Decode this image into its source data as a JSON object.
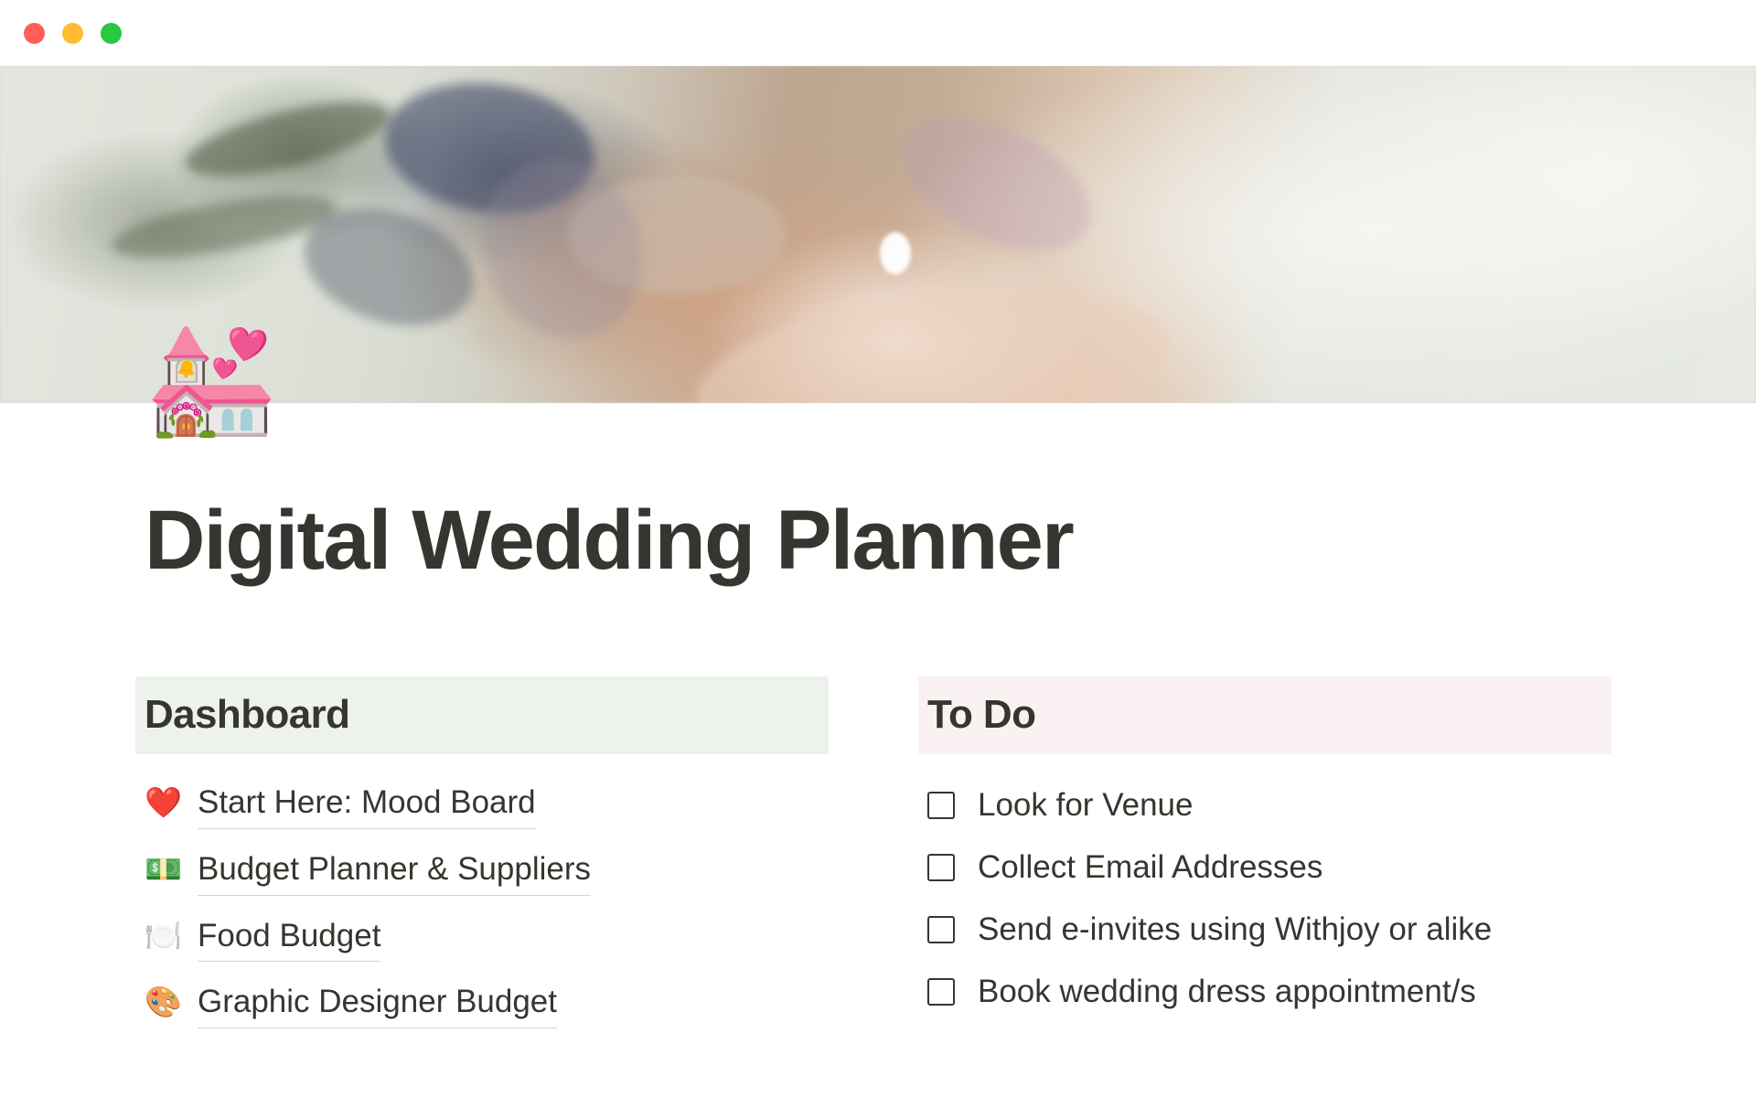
{
  "window": {
    "traffic_lights": [
      {
        "name": "close",
        "color": "#ff5f57"
      },
      {
        "name": "minimize",
        "color": "#febc2e"
      },
      {
        "name": "zoom",
        "color": "#28c840"
      }
    ]
  },
  "cover": {
    "alt": "blurred photo of hands holding dried floral bouquet with engagement ring"
  },
  "page": {
    "icon": "💒",
    "title": "Digital Wedding Planner"
  },
  "dashboard": {
    "heading": "Dashboard",
    "highlight_color": "#edf3ec",
    "links": [
      {
        "emoji": "❤️",
        "label": "Start Here: Mood Board"
      },
      {
        "emoji": "💵",
        "label": "Budget Planner & Suppliers"
      },
      {
        "emoji": "🍽️",
        "label": "Food Budget"
      },
      {
        "emoji": "🎨",
        "label": "Graphic Designer Budget"
      }
    ]
  },
  "todo": {
    "heading": "To Do",
    "highlight_color": "#faf1f3",
    "items": [
      {
        "label": "Look for Venue",
        "checked": false
      },
      {
        "label": "Collect Email Addresses",
        "checked": false
      },
      {
        "label": "Send e-invites using Withjoy or alike",
        "checked": false
      },
      {
        "label": "Book wedding dress appointment/s",
        "checked": false
      }
    ]
  }
}
